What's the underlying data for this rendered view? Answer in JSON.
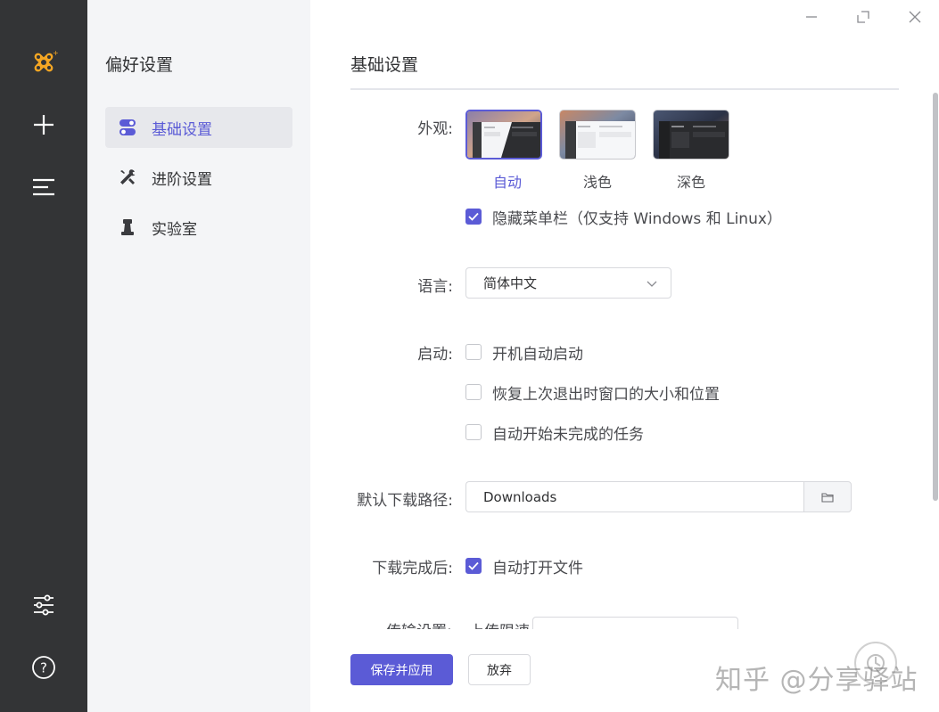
{
  "subnav": {
    "title": "偏好设置",
    "items": [
      {
        "label": "基础设置"
      },
      {
        "label": "进阶设置"
      },
      {
        "label": "实验室"
      }
    ]
  },
  "main": {
    "title": "基础设置",
    "appearance": {
      "label": "外观:",
      "options": [
        {
          "label": "自动",
          "selected": true
        },
        {
          "label": "浅色",
          "selected": false
        },
        {
          "label": "深色",
          "selected": false
        }
      ],
      "hide_menubar": {
        "label": "隐藏菜单栏（仅支持 Windows 和 Linux）",
        "checked": true
      }
    },
    "language": {
      "label": "语言:",
      "value": "简体中文"
    },
    "startup": {
      "label": "启动:",
      "options": [
        {
          "label": "开机自动启动",
          "checked": false
        },
        {
          "label": "恢复上次退出时窗口的大小和位置",
          "checked": false
        },
        {
          "label": "自动开始未完成的任务",
          "checked": false
        }
      ]
    },
    "download_path": {
      "label": "默认下载路径:",
      "value": "Downloads"
    },
    "after_download": {
      "label": "下载完成后:",
      "option": {
        "label": "自动打开文件",
        "checked": true
      }
    },
    "transfer": {
      "label": "传输设置:",
      "sub_label": "上传限速"
    }
  },
  "footer": {
    "save_label": "保存并应用",
    "discard_label": "放弃",
    "watermark": "知乎 @分享驿站"
  },
  "colors": {
    "accent": "#5b5bd6",
    "rail": "#333436",
    "subnav": "#f4f5f7"
  }
}
